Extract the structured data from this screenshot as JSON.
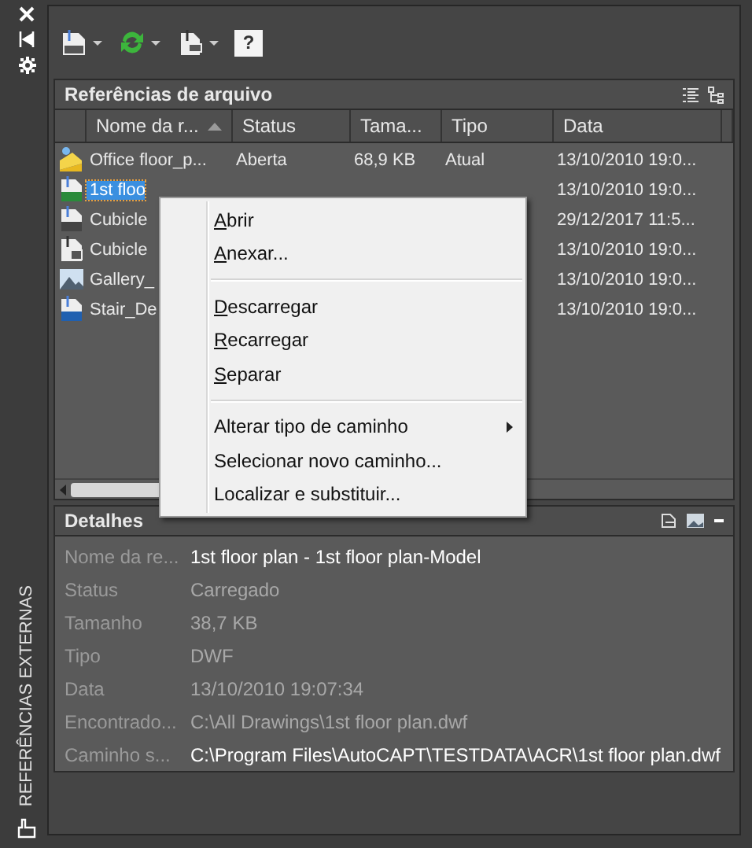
{
  "side_strip": {
    "title": "REFERÊNCIAS EXTERNAS"
  },
  "toolbar": {
    "help_label": "?"
  },
  "file_references": {
    "title": "Referências de arquivo",
    "columns": [
      {
        "label": "Nome da r...",
        "sorted": true
      },
      {
        "label": "Status",
        "sorted": false
      },
      {
        "label": "Tama...",
        "sorted": false
      },
      {
        "label": "Tipo",
        "sorted": false
      },
      {
        "label": "Data",
        "sorted": false
      }
    ],
    "rows": [
      {
        "kind": "current",
        "selected": false,
        "cells": [
          "Office floor_p...",
          "Aberta",
          "68,9 KB",
          "Atual",
          "13/10/2010 19:0..."
        ]
      },
      {
        "kind": "dwf",
        "selected": true,
        "cells": [
          "1st floo",
          "",
          "",
          "",
          "13/10/2010 19:0..."
        ]
      },
      {
        "kind": "dwg",
        "selected": false,
        "cells": [
          "Cubicle",
          "",
          "",
          "",
          "29/12/2017 11:5..."
        ]
      },
      {
        "kind": "pdf",
        "selected": false,
        "cells": [
          "Cubicle",
          "",
          "",
          "",
          "13/10/2010 19:0..."
        ]
      },
      {
        "kind": "image",
        "selected": false,
        "cells": [
          "Gallery_",
          "",
          "",
          "",
          "13/10/2010 19:0..."
        ]
      },
      {
        "kind": "dgn",
        "selected": false,
        "cells": [
          "Stair_De",
          "",
          "",
          "",
          "13/10/2010 19:0..."
        ]
      }
    ]
  },
  "context_menu": {
    "items": [
      {
        "kind": "item",
        "label": "Abrir",
        "underline_first": true,
        "submenu": false
      },
      {
        "kind": "item",
        "label": "Anexar...",
        "underline_first": true,
        "submenu": false
      },
      {
        "kind": "separator"
      },
      {
        "kind": "item",
        "label": "Descarregar",
        "underline_first": true,
        "submenu": false
      },
      {
        "kind": "item",
        "label": "Recarregar",
        "underline_first": true,
        "submenu": false
      },
      {
        "kind": "item",
        "label": "Separar",
        "underline_first": true,
        "submenu": false
      },
      {
        "kind": "separator"
      },
      {
        "kind": "item",
        "label": "Alterar tipo de caminho",
        "underline_first": false,
        "submenu": true
      },
      {
        "kind": "item",
        "label": "Selecionar novo caminho...",
        "underline_first": false,
        "submenu": false
      },
      {
        "kind": "item",
        "label": "Localizar e substituir...",
        "underline_first": false,
        "submenu": false
      }
    ]
  },
  "details": {
    "title": "Detalhes",
    "fields": [
      {
        "label": "Nome da re...",
        "value": "1st floor plan - 1st floor plan-Model",
        "editable": true
      },
      {
        "label": "Status",
        "value": "Carregado",
        "editable": false
      },
      {
        "label": "Tamanho",
        "value": "38,7 KB",
        "editable": false
      },
      {
        "label": "Tipo",
        "value": "DWF",
        "editable": false
      },
      {
        "label": "Data",
        "value": "13/10/2010 19:07:34",
        "editable": false
      },
      {
        "label": "Encontrado...",
        "value": "C:\\All Drawings\\1st floor plan.dwf",
        "editable": false
      },
      {
        "label": "Caminho s...",
        "value": "C:\\Program Files\\AutoCAPT\\TESTDATA\\ACR\\1st floor plan.dwf",
        "editable": true
      }
    ]
  }
}
